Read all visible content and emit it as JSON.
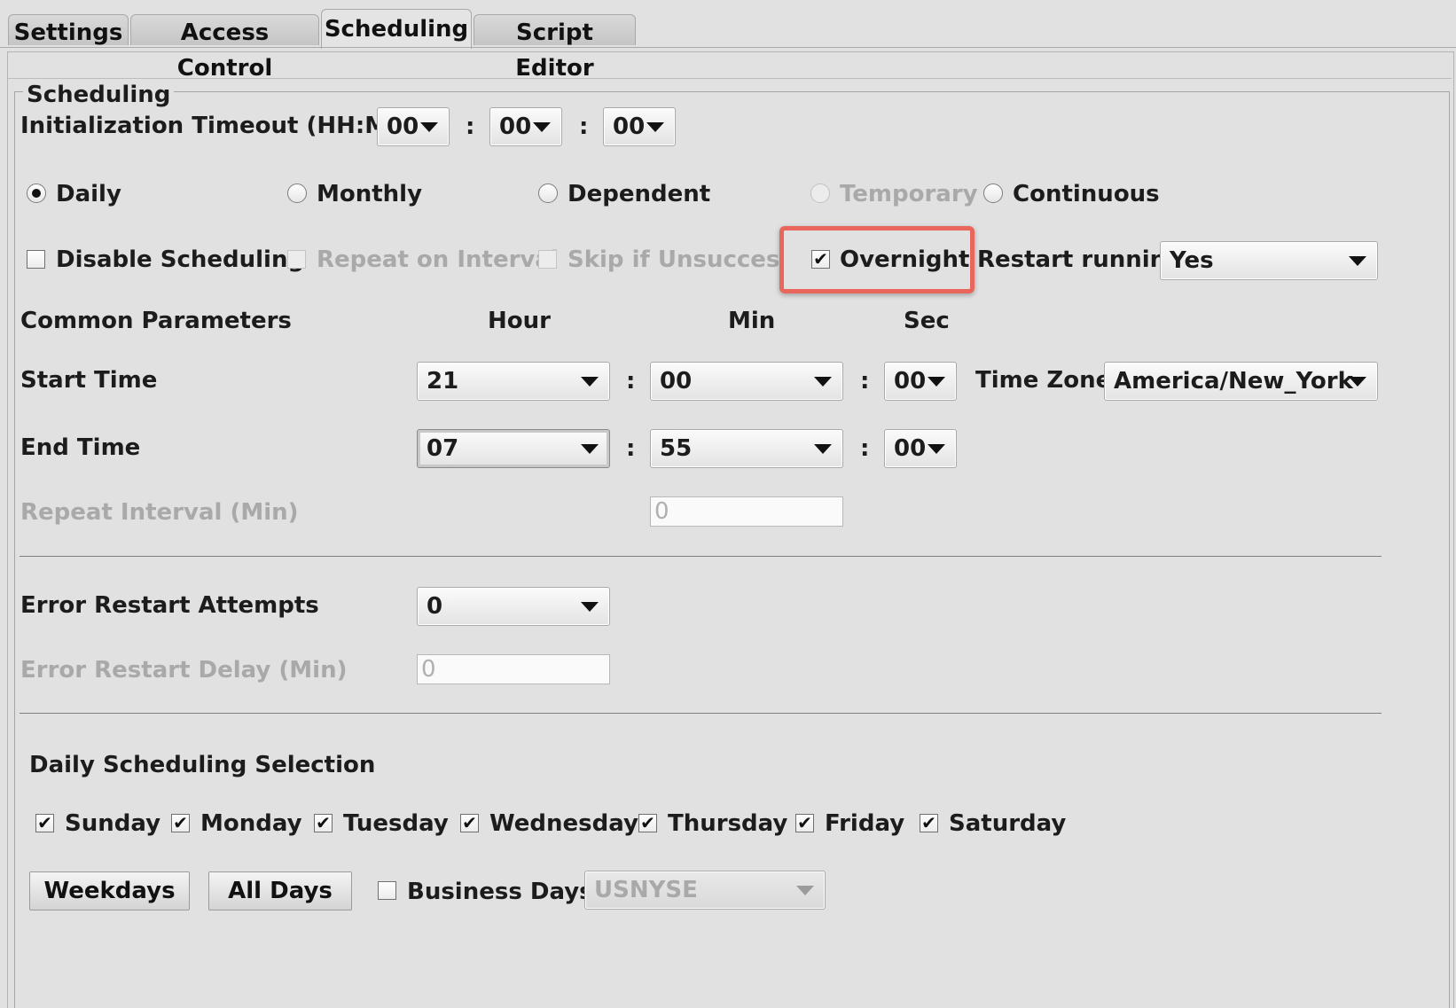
{
  "tabs": [
    "Settings",
    "Access Control",
    "Scheduling",
    "Script Editor"
  ],
  "section_title": "Scheduling",
  "init_timeout": {
    "label": "Initialization Timeout (HH:MI:SS)",
    "hh": "00",
    "mi": "00",
    "ss": "00",
    "sep": ":"
  },
  "schedule_types": {
    "daily": "Daily",
    "monthly": "Monthly",
    "dependent": "Dependent",
    "temporary": "Temporary",
    "continuous": "Continuous",
    "selected": "Daily"
  },
  "options": {
    "disable_scheduling": "Disable Scheduling",
    "repeat_on_interval": "Repeat on Interval",
    "skip_if_unsuccessful": "Skip if Unsuccessful",
    "overnight": "Overnight",
    "check_mark": "✔",
    "restart_running_label": "Restart running",
    "restart_running_value": "Yes"
  },
  "common": {
    "label": "Common Parameters",
    "hour": "Hour",
    "min": "Min",
    "sec": "Sec"
  },
  "start_time": {
    "label": "Start Time",
    "hour": "21",
    "min": "00",
    "sec": "00"
  },
  "time_zone": {
    "label": "Time Zone",
    "value": "America/New_York"
  },
  "end_time": {
    "label": "End Time",
    "hour": "07",
    "min": "55",
    "sec": "00"
  },
  "repeat_interval": {
    "label": "Repeat Interval (Min)",
    "value": "0"
  },
  "error_restart_attempts": {
    "label": "Error Restart Attempts",
    "value": "0"
  },
  "error_restart_delay": {
    "label": "Error Restart Delay (Min)",
    "value": "0"
  },
  "daily_selection": {
    "label": "Daily Scheduling Selection",
    "days": [
      "Sunday",
      "Monday",
      "Tuesday",
      "Wednesday",
      "Thursday",
      "Friday",
      "Saturday"
    ]
  },
  "buttons": {
    "weekdays": "Weekdays",
    "all_days": "All Days"
  },
  "business_days": {
    "label": "Business Days",
    "calendar": "USNYSE"
  },
  "colors": {
    "highlight": "#e8675a"
  }
}
